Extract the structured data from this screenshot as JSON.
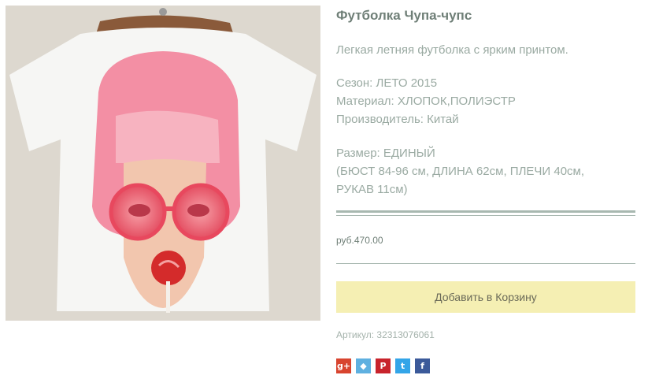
{
  "product": {
    "title": "Футболка Чупа-чупс",
    "description": "Легкая летняя футболка с ярким принтом.",
    "specs": [
      "Сезон: ЛЕТО 2015",
      "Материал: ХЛОПОК,ПОЛИЭСТР",
      "Производитель: Китай"
    ],
    "size_lines": [
      "Размер: ЕДИНЫЙ",
      "(БЮСТ 84-96 см, ДЛИНА 62см, ПЛЕЧИ 40см,",
      "РУКАВ 11см)"
    ],
    "price": "руб.470.00",
    "add_to_cart_label": "Добавить в Корзину",
    "sku": "Артикул: 32313076061"
  },
  "share": [
    {
      "name": "google-plus-icon",
      "glyph": "g+",
      "color": "#d8442f"
    },
    {
      "name": "mail-ru-icon",
      "glyph": "◆",
      "color": "#5fb0e0"
    },
    {
      "name": "pinterest-icon",
      "glyph": "P",
      "color": "#c8232c"
    },
    {
      "name": "twitter-icon",
      "glyph": "t",
      "color": "#33a5e8"
    },
    {
      "name": "facebook-icon",
      "glyph": "f",
      "color": "#3b5a9a"
    }
  ],
  "colors": {
    "cart_button_bg": "#f5efb3",
    "rule": "#a8b8b0"
  }
}
